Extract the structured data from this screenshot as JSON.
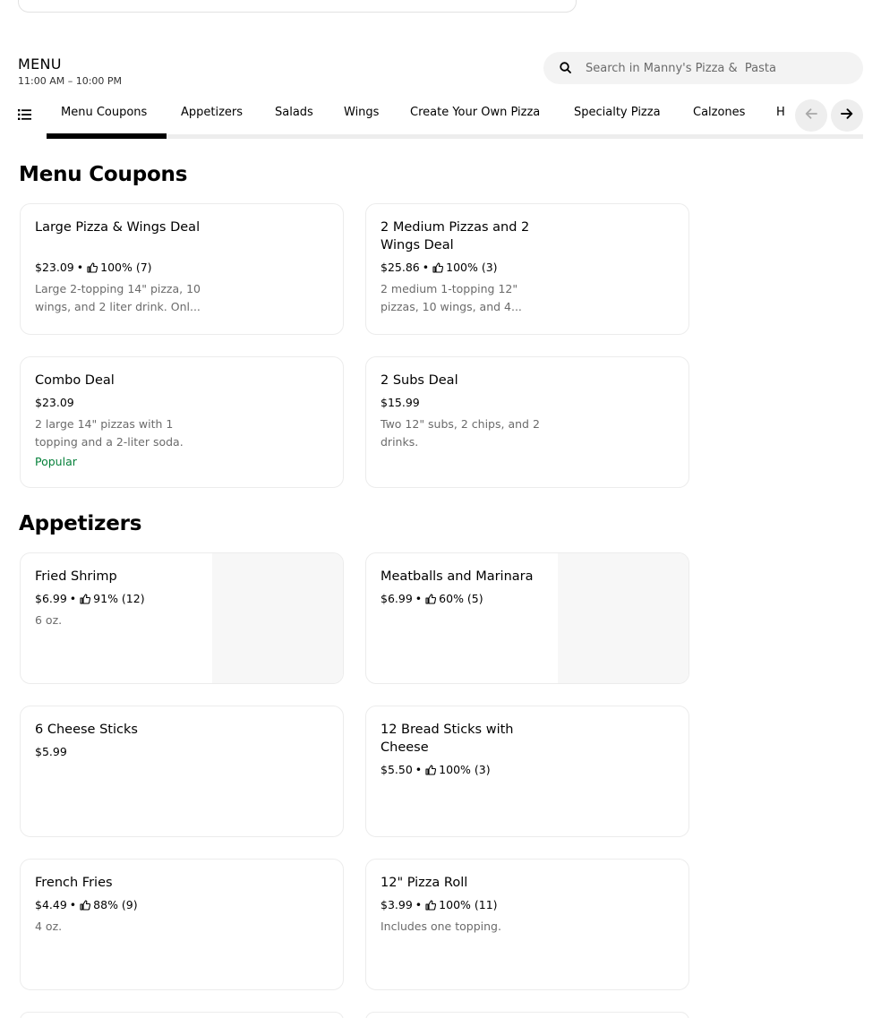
{
  "menu": {
    "title": "MENU",
    "hours": "11:00 AM – 10:00 PM"
  },
  "search": {
    "placeholder": "Search in Manny's Pizza &  Pasta"
  },
  "tabs": [
    "Menu Coupons",
    "Appetizers",
    "Salads",
    "Wings",
    "Create Your Own Pizza",
    "Specialty Pizza",
    "Calzones",
    "H"
  ],
  "active_tab": "Menu Coupons",
  "sections": {
    "coupons": {
      "title": "Menu Coupons",
      "items": [
        {
          "name": "Large Pizza & Wings Deal",
          "price": "$23.09",
          "rating": "100% (7)",
          "desc": "Large 2-topping 14\" pizza, 10 wings, and 2 liter drink. Onl..."
        },
        {
          "name": "2 Medium Pizzas and 2 Wings Deal",
          "price": "$25.86",
          "rating": "100% (3)",
          "desc": "2 medium 1-topping 12\" pizzas, 10 wings, and 4..."
        },
        {
          "name": "Combo Deal",
          "price": "$23.09",
          "desc": "2 large 14\" pizzas with 1 topping and a 2-liter soda.",
          "badge": "Popular"
        },
        {
          "name": "2 Subs Deal",
          "price": "$15.99",
          "desc": "Two 12\" subs, 2 chips, and 2 drinks."
        }
      ]
    },
    "appetizers": {
      "title": "Appetizers",
      "items": [
        {
          "name": "Fried Shrimp",
          "price": "$6.99",
          "rating": "91% (12)",
          "desc": "6 oz."
        },
        {
          "name": "Meatballs and Marinara",
          "price": "$6.99",
          "rating": "60% (5)"
        },
        {
          "name": "6 Cheese Sticks",
          "price": "$5.99"
        },
        {
          "name": "12 Bread Sticks with Cheese",
          "price": "$5.50",
          "rating": "100% (3)"
        },
        {
          "name": "French Fries",
          "price": "$4.49",
          "rating": "88% (9)",
          "desc": "4 oz."
        },
        {
          "name": "12\" Pizza Roll",
          "price": "$3.99",
          "rating": "100% (11)",
          "desc": "Includes one topping."
        }
      ]
    }
  },
  "separator": "•",
  "icons": {
    "search": "search-icon",
    "list": "list-icon",
    "thumb": "thumbs-up-icon",
    "prev": "arrow-left-icon",
    "next": "arrow-right-icon"
  }
}
